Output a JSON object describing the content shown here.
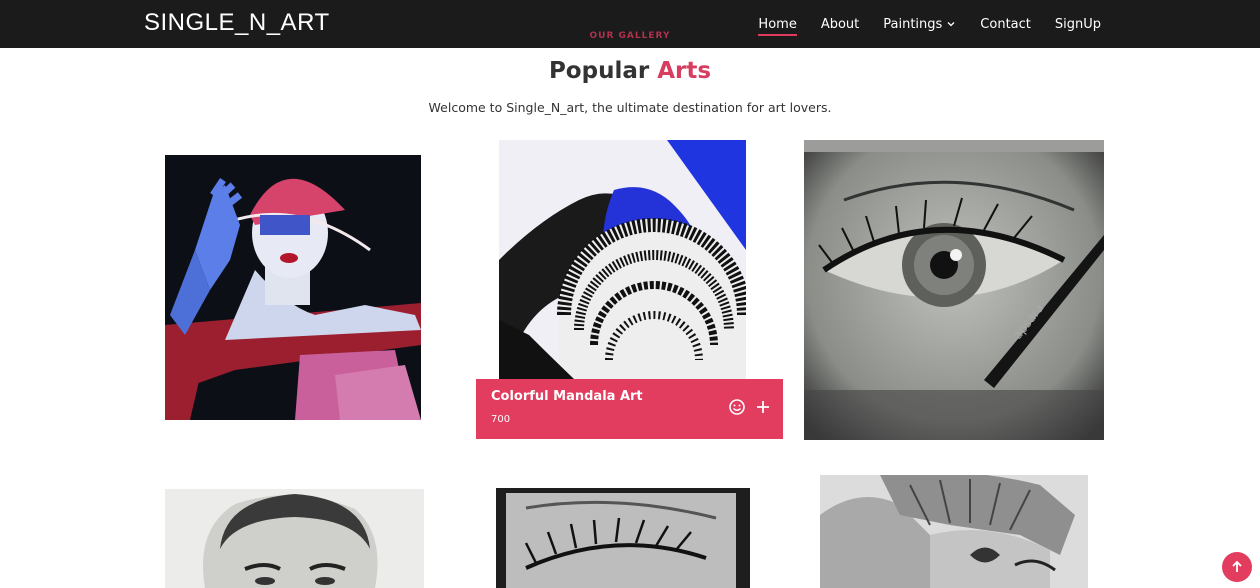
{
  "header": {
    "logo": "SINGLE_N_ART",
    "nav": [
      {
        "label": "Home",
        "active": true
      },
      {
        "label": "About"
      },
      {
        "label": "Paintings",
        "dropdown": true
      },
      {
        "label": "Contact"
      },
      {
        "label": "SignUp"
      }
    ]
  },
  "gallery": {
    "eyebrow": "OUR GALLERY",
    "title_main": "Popular",
    "title_accent": "Arts",
    "subtitle": "Welcome to Single_N_art, the ultimate destination for art lovers.",
    "active_card": {
      "title": "Colorful Mandala Art",
      "price": "700"
    }
  },
  "colors": {
    "accent": "#e23c5f",
    "header_bg": "#1b1b1b"
  },
  "icons": {
    "active_card_left": "smile-icon",
    "active_card_right": "plus-icon",
    "back_to_top": "arrow-up-icon",
    "nav_dropdown": "chevron-down-icon"
  }
}
